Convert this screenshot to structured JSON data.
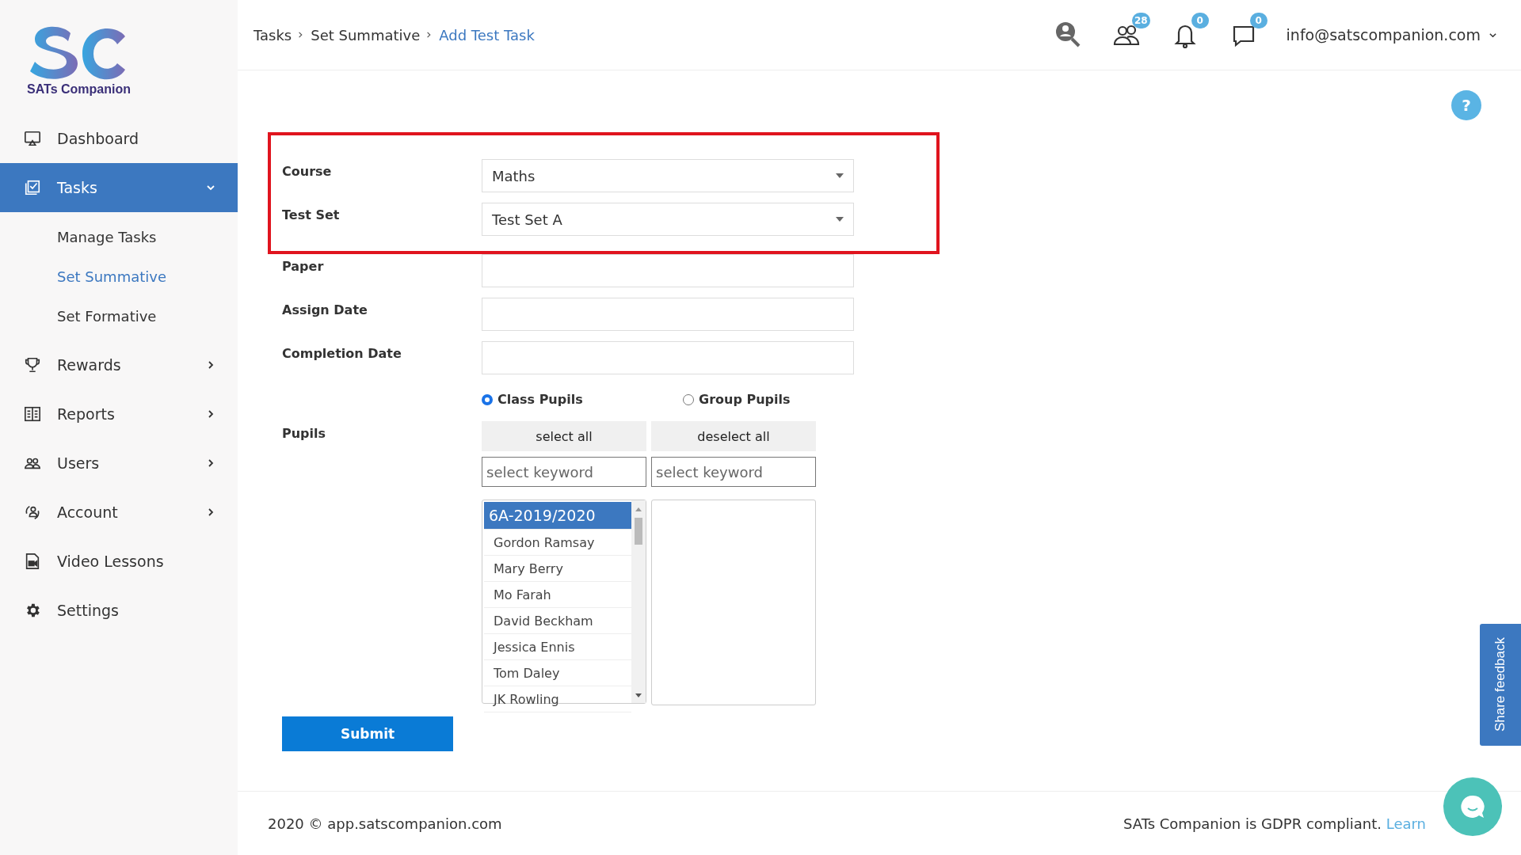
{
  "logo": {
    "text": "SATs Companion"
  },
  "sidebar": {
    "items": [
      {
        "label": "Dashboard",
        "selected": false
      },
      {
        "label": "Tasks",
        "selected": true,
        "expanded": true,
        "children": [
          {
            "label": "Manage Tasks",
            "selected": false
          },
          {
            "label": "Set Summative",
            "selected": true
          },
          {
            "label": "Set Formative",
            "selected": false
          }
        ]
      },
      {
        "label": "Rewards",
        "selected": false,
        "expanded": false
      },
      {
        "label": "Reports",
        "selected": false,
        "expanded": false
      },
      {
        "label": "Users",
        "selected": false,
        "expanded": false
      },
      {
        "label": "Account",
        "selected": false,
        "expanded": false
      },
      {
        "label": "Video Lessons",
        "selected": false
      },
      {
        "label": "Settings",
        "selected": false
      }
    ]
  },
  "breadcrumb": [
    {
      "label": "Tasks",
      "selected": false
    },
    {
      "label": "Set Summative",
      "selected": false
    },
    {
      "label": "Add Test Task",
      "selected": true
    }
  ],
  "header": {
    "badges": [
      {
        "count": "28"
      },
      {
        "count": "0"
      },
      {
        "count": "0"
      }
    ],
    "account": "info@satscompanion.com"
  },
  "help": {
    "label": "?"
  },
  "form": {
    "highlighted_fields": [
      {
        "label": "Course",
        "kind": "select",
        "value": "Maths"
      },
      {
        "label": "Test Set",
        "kind": "select",
        "value": "Test Set A"
      }
    ],
    "fields": [
      {
        "label": "Paper",
        "kind": "text"
      },
      {
        "label": "Assign Date",
        "kind": "text"
      },
      {
        "label": "Completion Date",
        "kind": "text"
      }
    ],
    "pupil_modes": [
      {
        "label": "Class Pupils",
        "selected": true
      },
      {
        "label": "Group Pupils",
        "selected": false
      }
    ],
    "pupils": {
      "label": "Pupils",
      "select_all": "select all",
      "deselect_all": "deselect all",
      "search_left": {
        "placeholder": "select keyword"
      },
      "search_right": {
        "placeholder": "select keyword"
      },
      "items": [
        {
          "label": "6A-2019/2020",
          "kind": "group",
          "selected": true
        },
        {
          "label": "Gordon Ramsay",
          "kind": "pupil",
          "selected": false
        },
        {
          "label": "Mary Berry",
          "kind": "pupil",
          "selected": false
        },
        {
          "label": "Mo Farah",
          "kind": "pupil",
          "selected": false
        },
        {
          "label": "David Beckham",
          "kind": "pupil",
          "selected": false
        },
        {
          "label": "Jessica Ennis",
          "kind": "pupil",
          "selected": false
        },
        {
          "label": "Tom Daley",
          "kind": "pupil",
          "selected": false
        },
        {
          "label": "JK Rowling",
          "kind": "pupil",
          "selected": false
        }
      ]
    },
    "submit": "Submit"
  },
  "footer": {
    "copyright": "2020 © app.satscompanion.com",
    "gdpr": "SATs Companion is GDPR compliant.",
    "link": "Learn"
  },
  "feedback_tab": "Share feedback"
}
